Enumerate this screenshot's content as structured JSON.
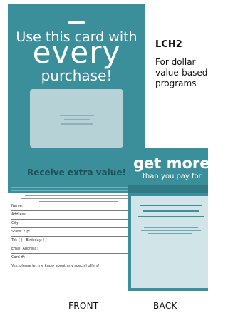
{
  "front": {
    "headline_1": "Use this card with",
    "headline_2": "every",
    "headline_3": "purchase!",
    "tagline": "Receive extra value!",
    "form_fields": [
      "Name:",
      "Address:",
      "City:",
      "State:  Zip:",
      "Tel: (   )   -   Birthday:  /  /",
      "Email Address:",
      "Card #:",
      "Yes, please let me know about any special offers!"
    ]
  },
  "product": {
    "code": "LCH2",
    "description": "For dollar value-based programs"
  },
  "back": {
    "headline_1": "get more",
    "headline_2": "than you pay for"
  },
  "labels": {
    "front": "FRONT",
    "back": "BACK"
  },
  "colors": {
    "card_teal": "#3a8f9b",
    "panel_light": "#d1e4e7"
  }
}
